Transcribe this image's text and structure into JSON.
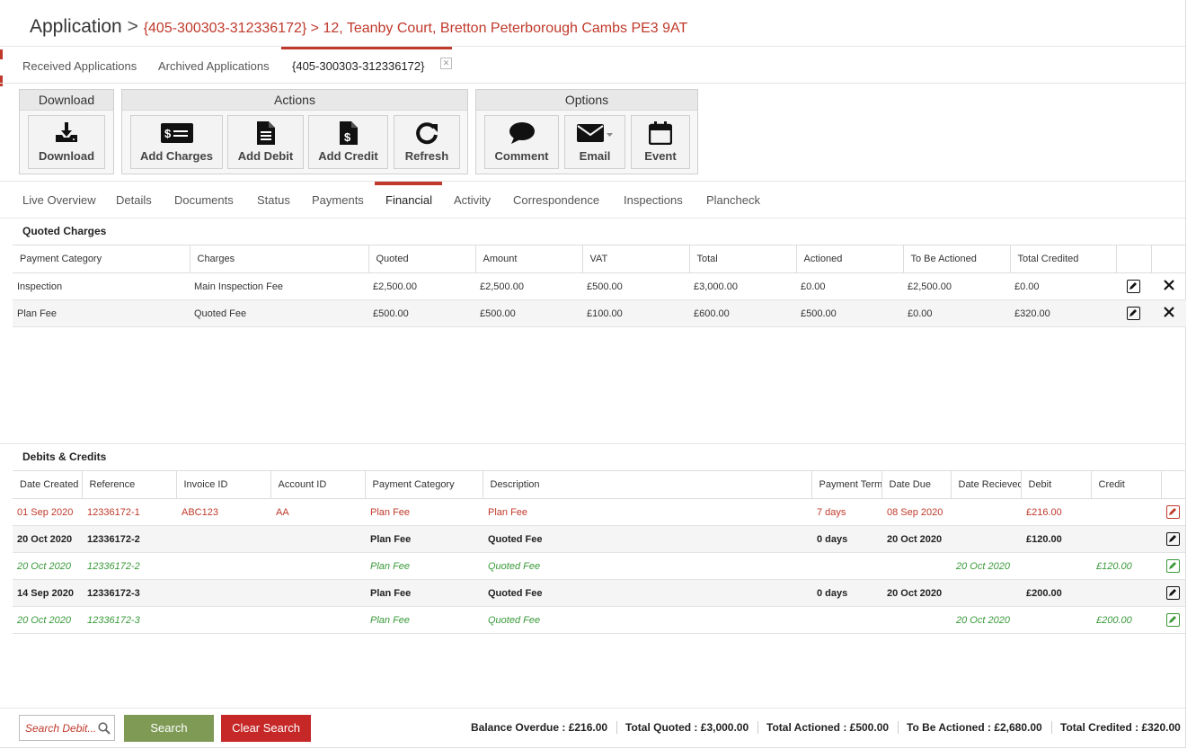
{
  "header": {
    "app_label": "Application",
    "separator": ">",
    "path": "{405-300303-312336172} > 12, Teanby Court, Bretton Peterborough Cambs PE3 9AT"
  },
  "app_tabs": [
    {
      "label": "Received Applications"
    },
    {
      "label": "Archived Applications"
    },
    {
      "label": "{405-300303-312336172}"
    }
  ],
  "toolbar": {
    "download_group": "Download",
    "actions_group": "Actions",
    "options_group": "Options",
    "download": "Download",
    "add_charges": "Add Charges",
    "add_debit": "Add Debit",
    "add_credit": "Add Credit",
    "refresh": "Refresh",
    "comment": "Comment",
    "email": "Email",
    "event": "Event"
  },
  "nav_tabs": [
    {
      "label": "Live Overview"
    },
    {
      "label": "Details"
    },
    {
      "label": "Documents"
    },
    {
      "label": "Status"
    },
    {
      "label": "Payments"
    },
    {
      "label": "Financial"
    },
    {
      "label": "Activity"
    },
    {
      "label": "Correspondence"
    },
    {
      "label": "Inspections"
    },
    {
      "label": "Plancheck"
    }
  ],
  "quoted": {
    "title": "Quoted Charges",
    "headers": [
      "Payment Category",
      "Charges",
      "Quoted",
      "Amount",
      "VAT",
      "Total",
      "Actioned",
      "To Be Actioned",
      "Total Credited"
    ],
    "rows": [
      [
        "Inspection",
        "Main Inspection Fee",
        "£2,500.00",
        "£2,500.00",
        "£500.00",
        "£3,000.00",
        "£0.00",
        "£2,500.00",
        "£0.00"
      ],
      [
        "Plan Fee",
        "Quoted Fee",
        "£500.00",
        "£500.00",
        "£100.00",
        "£600.00",
        "£500.00",
        "£0.00",
        "£320.00"
      ]
    ]
  },
  "debits": {
    "title": "Debits & Credits",
    "headers": [
      "Date Created",
      "Reference",
      "Invoice ID",
      "Account ID",
      "Payment Category",
      "Description",
      "Payment Terms",
      "Date Due",
      "Date Recieved",
      "Debit",
      "Credit"
    ],
    "rows": [
      [
        "01 Sep 2020",
        "12336172-1",
        "ABC123",
        "AA",
        "Plan Fee",
        "Plan Fee",
        "7 days",
        "08 Sep 2020",
        "",
        "£216.00",
        ""
      ],
      [
        "20 Oct 2020",
        "12336172-2",
        "",
        "",
        "Plan Fee",
        "Quoted Fee",
        "0 days",
        "20 Oct 2020",
        "",
        "£120.00",
        ""
      ],
      [
        "20 Oct 2020",
        "12336172-2",
        "",
        "",
        "Plan Fee",
        "Quoted Fee",
        "",
        "",
        "20 Oct 2020",
        "",
        "£120.00"
      ],
      [
        "14 Sep 2020",
        "12336172-3",
        "",
        "",
        "Plan Fee",
        "Quoted Fee",
        "0 days",
        "20 Oct 2020",
        "",
        "£200.00",
        ""
      ],
      [
        "20 Oct 2020",
        "12336172-3",
        "",
        "",
        "Plan Fee",
        "Quoted Fee",
        "",
        "",
        "20 Oct 2020",
        "",
        "£200.00"
      ]
    ]
  },
  "footer": {
    "search_placeholder": "Search Debit...",
    "search_button": "Search",
    "clear_button": "Clear Search",
    "balance_overdue": "Balance Overdue : £216.00",
    "total_quoted": "Total Quoted : £3,000.00",
    "total_actioned": "Total Actioned : £500.00",
    "to_be_actioned": "To Be Actioned : £2,680.00",
    "total_credited": "Total Credited : £320.00"
  },
  "colors": {
    "accent": "#c0392b",
    "search_button": "#7e9a55",
    "clear_button": "#c62828",
    "credit_text": "#3a9a3a"
  }
}
